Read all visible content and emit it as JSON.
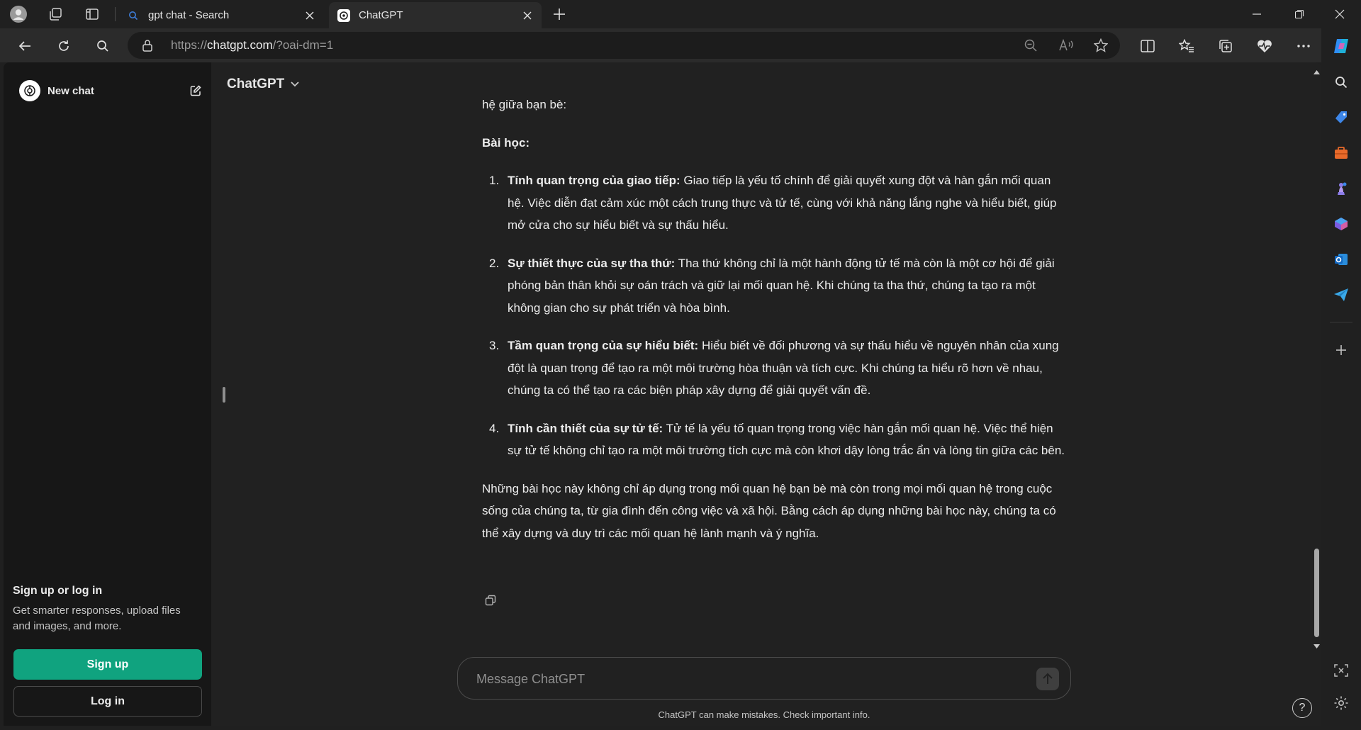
{
  "browser": {
    "tabs": [
      {
        "label": "gpt chat - Search",
        "active": false
      },
      {
        "label": "ChatGPT",
        "active": true
      }
    ],
    "url_prefix": "https://",
    "url_host": "chatgpt.com",
    "url_path": "/?oai-dm=1"
  },
  "sidebar": {
    "new_chat_label": "New chat",
    "signup_title": "Sign up or log in",
    "signup_desc": "Get smarter responses, upload files and images, and more.",
    "signup_button": "Sign up",
    "login_button": "Log in"
  },
  "header": {
    "model_label": "ChatGPT"
  },
  "message": {
    "partial_top": "... ... ... ... ... ...",
    "intro_tail": "hệ giữa bạn bè:",
    "heading": "Bài học:",
    "items": [
      {
        "num": "1.",
        "title": "Tính quan trọng của giao tiếp:",
        "text": " Giao tiếp là yếu tố chính để giải quyết xung đột và hàn gắn mối quan hệ. Việc diễn đạt cảm xúc một cách trung thực và tử tế, cùng với khả năng lắng nghe và hiểu biết, giúp mở cửa cho sự hiểu biết và sự thấu hiểu."
      },
      {
        "num": "2.",
        "title": "Sự thiết thực của sự tha thứ:",
        "text": " Tha thứ không chỉ là một hành động tử tế mà còn là một cơ hội để giải phóng bản thân khỏi sự oán trách và giữ lại mối quan hệ. Khi chúng ta tha thứ, chúng ta tạo ra một không gian cho sự phát triển và hòa bình."
      },
      {
        "num": "3.",
        "title": "Tầm quan trọng của sự hiểu biết:",
        "text": " Hiểu biết về đối phương và sự thấu hiểu về nguyên nhân của xung đột là quan trọng để tạo ra một môi trường hòa thuận và tích cực. Khi chúng ta hiểu rõ hơn về nhau, chúng ta có thể tạo ra các biện pháp xây dựng để giải quyết vấn đề."
      },
      {
        "num": "4.",
        "title": "Tính cần thiết của sự tử tế:",
        "text": " Tử tế là yếu tố quan trọng trong việc hàn gắn mối quan hệ. Việc thể hiện sự tử tế không chỉ tạo ra một môi trường tích cực mà còn khơi dậy lòng trắc ẩn và lòng tin giữa các bên."
      }
    ],
    "conclusion": "Những bài học này không chỉ áp dụng trong mối quan hệ bạn bè mà còn trong mọi mối quan hệ trong cuộc sống của chúng ta, từ gia đình đến công việc và xã hội. Bằng cách áp dụng những bài học này, chúng ta có thể xây dựng và duy trì các mối quan hệ lành mạnh và ý nghĩa."
  },
  "composer": {
    "placeholder": "Message ChatGPT",
    "disclaimer": "ChatGPT can make mistakes. Check important info."
  },
  "help_label": "?",
  "colors": {
    "accent": "#10a37f",
    "sidebar_bg": "#171717",
    "main_bg": "#212121"
  }
}
